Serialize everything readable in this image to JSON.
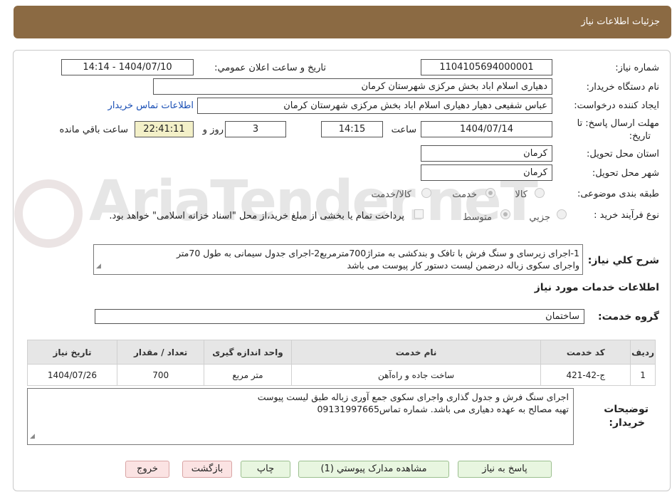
{
  "header": {
    "title": "جزئیات اطلاعات نیاز"
  },
  "watermark": {
    "text": "AriaTender.neT"
  },
  "form": {
    "need_number_label": "شماره نیاز:",
    "need_number": "1104105694000001",
    "announce_label": "تاریخ و ساعت اعلان عمومي:",
    "announce_value": "1404/07/10 - 14:14",
    "buyer_org_label": "نام دستگاه خريدار:",
    "buyer_org": "دهیاری اسلام اباد بخش مرکزی شهرستان کرمان",
    "creator_label": "ايجاد کننده درخواست:",
    "creator": "عباس شفیعی دهیار دهیاری اسلام اباد بخش مرکزی شهرستان کرمان",
    "contact_link": "اطلاعات تماس خریدار",
    "deadline_label_1": "مهلت ارسال پاسخ: تا",
    "deadline_label_2": "تاریخ:",
    "deadline_date": "1404/07/14",
    "time_label": "ساعت",
    "deadline_time": "14:15",
    "days_value": "3",
    "days_label": "روز و",
    "remaining_time": "22:41:11",
    "remaining_label": "ساعت باقي مانده",
    "province_label": "استان محل تحویل:",
    "province": "کرمان",
    "city_label": "شهر محل تحویل:",
    "city": "کرمان",
    "category_label": "طبقه بندی موضوعی:",
    "category_options": [
      "کالا",
      "خدمت",
      "کالا/خدمت"
    ],
    "category_selected": "خدمت",
    "process_label": "نوع فرآیند خرید :",
    "process_options": [
      "جزيي",
      "متوسط"
    ],
    "process_selected": "متوسط",
    "payment_note": "پرداخت تمام یا بخشی از مبلغ خرید،از محل \"اسناد خزانه اسلامی\" خواهد بود.",
    "summary_label": "شرح کلي نياز:",
    "summary_line1": "1-اجرای زیرسای و سنگ فرش با تافک و بندکشی به متراژ700مترمربع2-اجرای جدول سیمانی به طول 70متر",
    "summary_line2": "واجرای سکوی زباله درضمن لیست دستور کار پیوست می باشد"
  },
  "services": {
    "section_title": "اطلاعات خدمات مورد نياز",
    "group_label": "گروه خدمت:",
    "group_value": "ساختمان",
    "columns": [
      "رديف",
      "کد خدمت",
      "نام خدمت",
      "واحد اندازه گیری",
      "تعداد / مقدار",
      "تاریخ نیاز"
    ],
    "rows": [
      [
        "1",
        "ج-42-421",
        "ساخت جاده و راه‌آهن",
        "متر مربع",
        "700",
        "1404/07/26"
      ]
    ]
  },
  "buyer_notes": {
    "label_1": "توضیحات",
    "label_2": "خریدار:",
    "line1": "اجرای سنگ فرش و جدول گذاری واجرای سکوی جمع آوری زباله طبق لیست پیوست",
    "line2": "تهیه مصالح به عهده دهیاری می باشد. شماره تماس09131997665"
  },
  "buttons": {
    "reply": "پاسخ به نياز",
    "attachments": "مشاهده مدارک پيوستي (1)",
    "print": "چاپ",
    "back": "بازگشت",
    "exit": "خروج"
  }
}
